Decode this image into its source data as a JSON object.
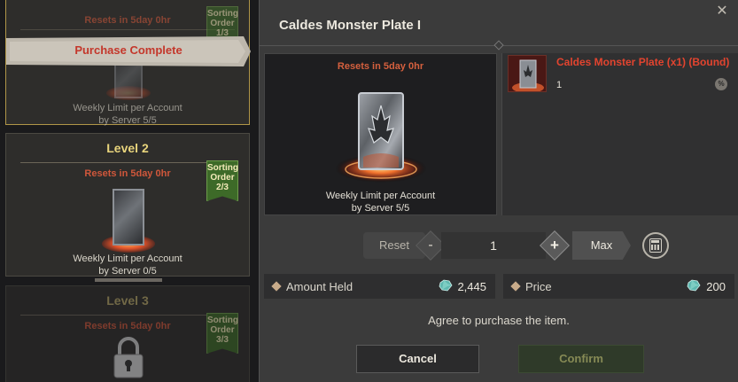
{
  "left_list": {
    "card1": {
      "reset_text": "Resets in 5day 0hr",
      "banner": "Purchase Complete",
      "sort_label": "Sorting Order",
      "sort_value": "1/3",
      "weekly_line1": "Weekly Limit per Account",
      "weekly_line2": "by Server 5/5"
    },
    "card2": {
      "title": "Level 2",
      "reset_text": "Resets in 5day 0hr",
      "sort_label": "Sorting Order",
      "sort_value": "2/3",
      "weekly_line1": "Weekly Limit per Account",
      "weekly_line2": "by Server 0/5"
    },
    "card3": {
      "title": "Level 3",
      "reset_text": "Resets in 5day 0hr",
      "sort_label": "Sorting Order",
      "sort_value": "3/3",
      "icon": "lock-icon"
    }
  },
  "modal": {
    "title": "Caldes Monster Plate I",
    "close_icon": "close-icon",
    "preview": {
      "reset_text": "Resets in 5day 0hr",
      "weekly_line1": "Weekly Limit per Account",
      "weekly_line2": "by Server 5/5"
    },
    "reward": {
      "name": "Caldes Monster Plate (x1) (Bound)",
      "quantity": "1",
      "percent_icon": "%"
    },
    "controls": {
      "reset_label": "Reset",
      "minus_label": "-",
      "quantity_value": "1",
      "plus_label": "+",
      "max_label": "Max",
      "calc_icon": "calculator-icon"
    },
    "amount_held": {
      "label": "Amount Held",
      "value": "2,445"
    },
    "price": {
      "label": "Price",
      "value": "200"
    },
    "agree_text": "Agree to purchase the item.",
    "cancel_label": "Cancel",
    "confirm_label": "Confirm"
  },
  "colors": {
    "reset_text": "#d5603e",
    "reward_name": "#e3442f",
    "ribbon_green": "#3d6a28",
    "confirm_text": "#868a55"
  }
}
